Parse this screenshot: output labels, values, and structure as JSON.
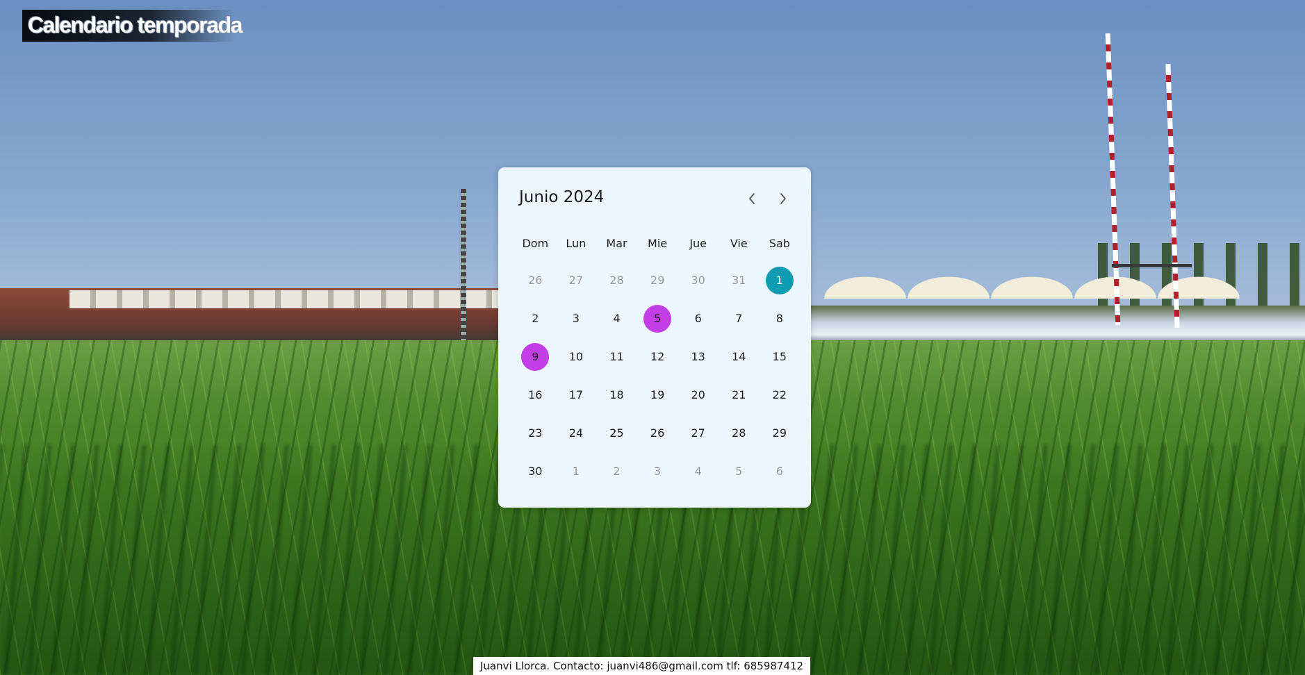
{
  "header": {
    "title": "Calendario temporada"
  },
  "calendar": {
    "month_label": "Junio 2024",
    "prev_icon": "chevron-left-icon",
    "next_icon": "chevron-right-icon",
    "weekdays": [
      "Dom",
      "Lun",
      "Mar",
      "Mie",
      "Jue",
      "Vie",
      "Sab"
    ],
    "days": [
      {
        "label": "26",
        "state": "other"
      },
      {
        "label": "27",
        "state": "other"
      },
      {
        "label": "28",
        "state": "other"
      },
      {
        "label": "29",
        "state": "other"
      },
      {
        "label": "30",
        "state": "other"
      },
      {
        "label": "31",
        "state": "other"
      },
      {
        "label": "1",
        "state": "today"
      },
      {
        "label": "2",
        "state": "cur"
      },
      {
        "label": "3",
        "state": "cur"
      },
      {
        "label": "4",
        "state": "cur"
      },
      {
        "label": "5",
        "state": "event"
      },
      {
        "label": "6",
        "state": "cur"
      },
      {
        "label": "7",
        "state": "cur"
      },
      {
        "label": "8",
        "state": "cur"
      },
      {
        "label": "9",
        "state": "event"
      },
      {
        "label": "10",
        "state": "cur"
      },
      {
        "label": "11",
        "state": "cur"
      },
      {
        "label": "12",
        "state": "cur"
      },
      {
        "label": "13",
        "state": "cur"
      },
      {
        "label": "14",
        "state": "cur"
      },
      {
        "label": "15",
        "state": "cur"
      },
      {
        "label": "16",
        "state": "cur"
      },
      {
        "label": "17",
        "state": "cur"
      },
      {
        "label": "18",
        "state": "cur"
      },
      {
        "label": "19",
        "state": "cur"
      },
      {
        "label": "20",
        "state": "cur"
      },
      {
        "label": "21",
        "state": "cur"
      },
      {
        "label": "22",
        "state": "cur"
      },
      {
        "label": "23",
        "state": "cur"
      },
      {
        "label": "24",
        "state": "cur"
      },
      {
        "label": "25",
        "state": "cur"
      },
      {
        "label": "26",
        "state": "cur"
      },
      {
        "label": "27",
        "state": "cur"
      },
      {
        "label": "28",
        "state": "cur"
      },
      {
        "label": "29",
        "state": "cur"
      },
      {
        "label": "30",
        "state": "cur"
      },
      {
        "label": "1",
        "state": "other"
      },
      {
        "label": "2",
        "state": "other"
      },
      {
        "label": "3",
        "state": "other"
      },
      {
        "label": "4",
        "state": "other"
      },
      {
        "label": "5",
        "state": "other"
      },
      {
        "label": "6",
        "state": "other"
      }
    ],
    "colors": {
      "today": "#0e9cb2",
      "event": "#c23ee6",
      "card": "#edf5fd"
    }
  },
  "footer": {
    "text": "Juanvi Llorca. Contacto: juanvi486@gmail.com tlf: 685987412"
  }
}
